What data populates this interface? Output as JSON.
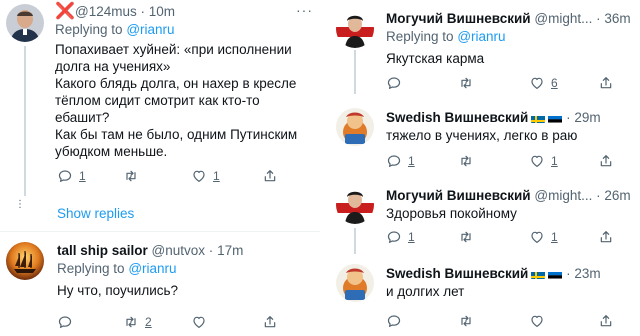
{
  "left": {
    "tweet1": {
      "x_mark": "❌",
      "handle": "@124mus",
      "dot": "·",
      "time": "10m",
      "replying_prefix": "Replying to",
      "replying_to": "@rianru",
      "lines": [
        "Попахивает хуйней: «при исполнении долга на учениях»",
        "Какого блядь долга, он нахер в кресле тёплом сидит смотрит как кто-то ебашит?",
        "Как бы там не было, одним Путинским убюдком меньше."
      ],
      "reply_count": "1",
      "retweet_count": "",
      "like_count": "1",
      "icons": {
        "reply": "comment-icon",
        "retweet": "retweet-icon",
        "like": "heart-icon",
        "share": "share-icon"
      }
    },
    "show_replies": "Show replies",
    "tweet2": {
      "name": "tall ship sailor",
      "handle": "@nutvox",
      "dot": "·",
      "time": "17m",
      "replying_prefix": "Replying to",
      "replying_to": "@rianru",
      "text": "Ну что, поучились?",
      "reply_count": "",
      "retweet_count": "2",
      "like_count": ""
    }
  },
  "right": {
    "tweets": [
      {
        "name": "Могучий Вишневский",
        "handle": "@might...",
        "dot": "·",
        "time": "36m",
        "replying_prefix": "Replying to",
        "replying_to": "@rianru",
        "text": "Якутская карма",
        "reply_count": "",
        "retweet_count": "",
        "like_count": "6"
      },
      {
        "name": "Swedish Вишневский",
        "flags": [
          "sweden-flag",
          "estonia-flag"
        ],
        "dot": "·",
        "time": "29m",
        "text": "тяжело в учениях, легко в раю",
        "reply_count": "1",
        "retweet_count": "",
        "like_count": "1"
      },
      {
        "name": "Могучий Вишневский",
        "handle": "@might...",
        "dot": "·",
        "time": "26m",
        "text": "Здоровья покойному",
        "reply_count": "1",
        "retweet_count": "",
        "like_count": "1"
      },
      {
        "name": "Swedish Вишневский",
        "flags": [
          "sweden-flag",
          "estonia-flag"
        ],
        "dot": "·",
        "time": "23m",
        "text": "и долгих лет",
        "reply_count": "",
        "retweet_count": "",
        "like_count": ""
      }
    ]
  },
  "colors": {
    "link": "#1d9bf0",
    "muted": "#536471",
    "text": "#0f1419",
    "x_mark": "#d32f2f",
    "thread_line": "#cfd9de"
  }
}
